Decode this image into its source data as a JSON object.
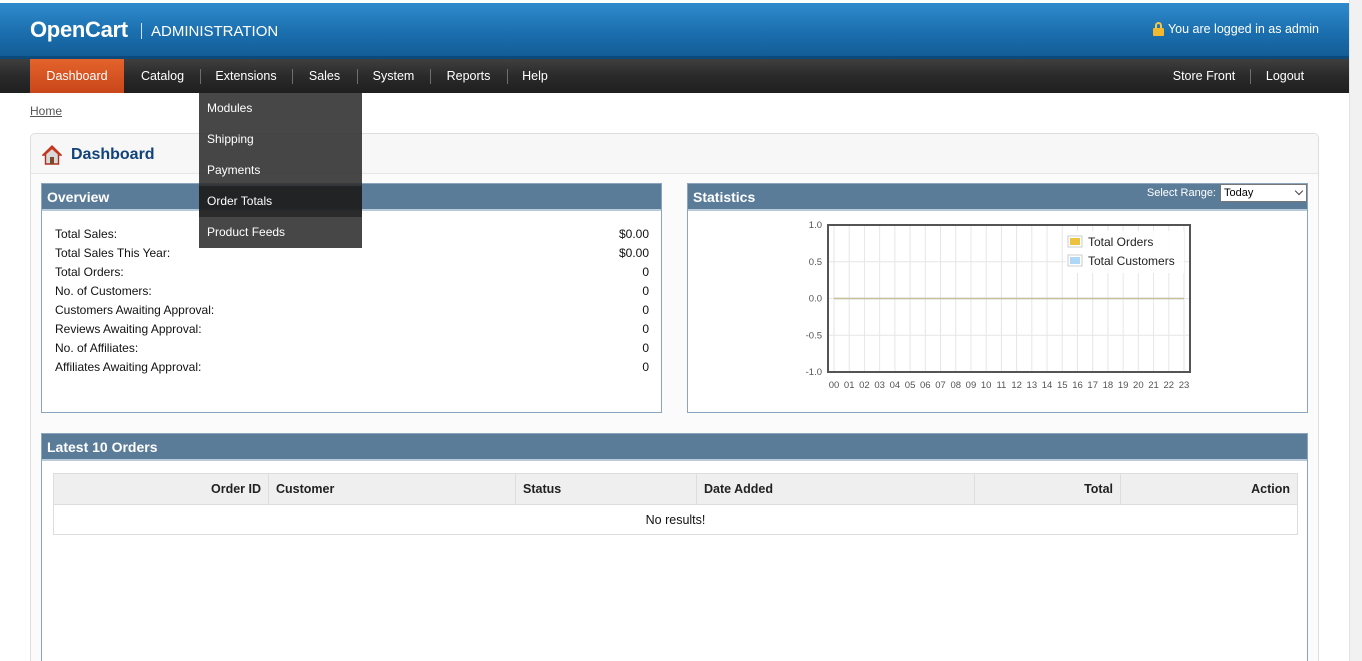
{
  "header": {
    "logo": "OpenCart",
    "subtitle": "ADMINISTRATION",
    "login_text": "You are logged in as admin"
  },
  "menu": {
    "items": [
      "Dashboard",
      "Catalog",
      "Extensions",
      "Sales",
      "System",
      "Reports",
      "Help"
    ],
    "active": "Dashboard",
    "right_items": [
      "Store Front",
      "Logout"
    ]
  },
  "dropdown": {
    "parent": "Extensions",
    "items": [
      "Modules",
      "Shipping",
      "Payments",
      "Order Totals",
      "Product Feeds"
    ],
    "hovered": "Order Totals"
  },
  "breadcrumb": {
    "home": "Home"
  },
  "page": {
    "title": "Dashboard"
  },
  "overview": {
    "title": "Overview",
    "rows": [
      {
        "label": "Total Sales:",
        "value": "$0.00"
      },
      {
        "label": "Total Sales This Year:",
        "value": "$0.00"
      },
      {
        "label": "Total Orders:",
        "value": "0"
      },
      {
        "label": "No. of Customers:",
        "value": "0"
      },
      {
        "label": "Customers Awaiting Approval:",
        "value": "0"
      },
      {
        "label": "Reviews Awaiting Approval:",
        "value": "0"
      },
      {
        "label": "No. of Affiliates:",
        "value": "0"
      },
      {
        "label": "Affiliates Awaiting Approval:",
        "value": "0"
      }
    ]
  },
  "statistics": {
    "title": "Statistics",
    "range_label": "Select Range:",
    "range_value": "Today"
  },
  "chart_data": {
    "type": "line",
    "x": [
      "00",
      "01",
      "02",
      "03",
      "04",
      "05",
      "06",
      "07",
      "08",
      "09",
      "10",
      "11",
      "12",
      "13",
      "14",
      "15",
      "16",
      "17",
      "18",
      "19",
      "20",
      "21",
      "22",
      "23"
    ],
    "series": [
      {
        "name": "Total Orders",
        "color": "#edc240",
        "values": [
          0,
          0,
          0,
          0,
          0,
          0,
          0,
          0,
          0,
          0,
          0,
          0,
          0,
          0,
          0,
          0,
          0,
          0,
          0,
          0,
          0,
          0,
          0,
          0
        ]
      },
      {
        "name": "Total Customers",
        "color": "#afd8f8",
        "values": [
          0,
          0,
          0,
          0,
          0,
          0,
          0,
          0,
          0,
          0,
          0,
          0,
          0,
          0,
          0,
          0,
          0,
          0,
          0,
          0,
          0,
          0,
          0,
          0
        ]
      }
    ],
    "ylim": [
      -1.0,
      1.0
    ],
    "yticks": [
      "1.0",
      "0.5",
      "0.0",
      "-0.5",
      "-1.0"
    ],
    "grid": true,
    "legend": "top-right"
  },
  "orders": {
    "title": "Latest 10 Orders",
    "columns": [
      "Order ID",
      "Customer",
      "Status",
      "Date Added",
      "Total",
      "Action"
    ],
    "empty": "No results!"
  }
}
